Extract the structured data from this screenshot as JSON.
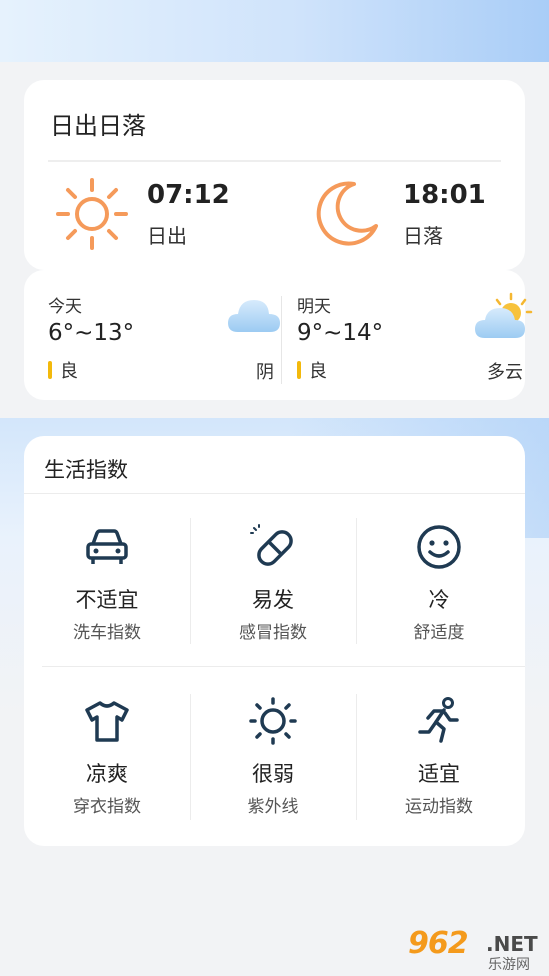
{
  "sun": {
    "title": "日出日落",
    "rise_time": "07:12",
    "rise_label": "日出",
    "set_time": "18:01",
    "set_label": "日落",
    "sun_color": "#f59a5a"
  },
  "forecast": {
    "today": {
      "day": "今天",
      "temp": "6°~13°",
      "aqi": "良",
      "condition": "阴",
      "icon": "cloud-icon"
    },
    "tomorrow": {
      "day": "明天",
      "temp": "9°~14°",
      "aqi": "良",
      "condition": "多云",
      "icon": "partly-cloudy-icon"
    },
    "aqi_color": "#f3b90c"
  },
  "life": {
    "title": "生活指数",
    "items": [
      {
        "value": "不适宜",
        "label": "洗车指数",
        "icon": "car-icon"
      },
      {
        "value": "易发",
        "label": "感冒指数",
        "icon": "pill-icon"
      },
      {
        "value": "冷",
        "label": "舒适度",
        "icon": "smiley-icon"
      },
      {
        "value": "凉爽",
        "label": "穿衣指数",
        "icon": "tshirt-icon"
      },
      {
        "value": "很弱",
        "label": "紫外线",
        "icon": "sun-icon"
      },
      {
        "value": "适宜",
        "label": "运动指数",
        "icon": "runner-icon"
      }
    ]
  },
  "watermark": {
    "number": "962",
    "domain": ".NET",
    "sub": "乐游网"
  }
}
